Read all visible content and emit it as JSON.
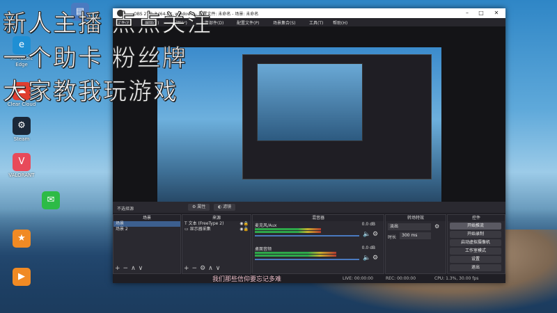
{
  "overlay": {
    "line1": "新人主播 点点关注",
    "line2": "一个助卡 粉丝牌",
    "line3": "大家教我玩游戏"
  },
  "desktop_icons": [
    {
      "label": "",
      "icon": "folder-icon",
      "color": "#4a7ac0"
    },
    {
      "label": "Microsoft Edge",
      "icon": "edge-icon",
      "color": "#1f8fd4"
    },
    {
      "label": "Clear Cloud",
      "icon": "cloud-icon",
      "color": "#e03e2f"
    },
    {
      "label": "Steam",
      "icon": "steam-icon",
      "color": "#1b2838"
    },
    {
      "label": "VALORANT",
      "icon": "valorant-icon",
      "color": "#e84a5a"
    },
    {
      "label": "",
      "icon": "wechat-icon",
      "color": "#2dbb46"
    },
    {
      "label": "",
      "icon": "app-icon",
      "color": "#f08a24"
    },
    {
      "label": "",
      "icon": "app2-icon",
      "color": "#f08a24"
    }
  ],
  "obs": {
    "title": "OBS 27.1.3 (64-bit, windows) - 配置文件: 未命名 - 场景: 未命名",
    "menu": [
      "文件(F)",
      "编辑(E)",
      "视图(V)",
      "停靠部件(D)",
      "配置文件(P)",
      "场景集合(S)",
      "工具(T)",
      "帮助(H)"
    ],
    "no_source": "不选择源",
    "props_btn": "属性",
    "filter_btn": "滤镜",
    "docks": {
      "scenes": {
        "title": "场景",
        "items": [
          "场景",
          "场景 2"
        ]
      },
      "sources": {
        "title": "来源",
        "items": [
          "文本 (FreeType 2)",
          "显示器采集"
        ]
      },
      "mixer": {
        "title": "混音器",
        "channels": [
          {
            "name": "麦克风/Aux",
            "db": "0.0 dB",
            "level": 0.63
          },
          {
            "name": "桌面音频",
            "db": "0.0 dB",
            "level": 0.78
          }
        ]
      },
      "transitions": {
        "title": "转场特效",
        "type": "淡出",
        "duration_label": "时长",
        "duration": "300 ms"
      },
      "controls": {
        "title": "控件",
        "buttons": [
          "开始推流",
          "开始录制",
          "启动虚拟摄像机",
          "工作室模式",
          "设置",
          "退出"
        ]
      }
    },
    "status": {
      "live": "LIVE: 00:00:00",
      "rec": "REC: 00:00:00",
      "cpu": "CPU: 1.3%, 30.00 fps"
    }
  },
  "subtitle": "我们那些信仰要忘记多难"
}
